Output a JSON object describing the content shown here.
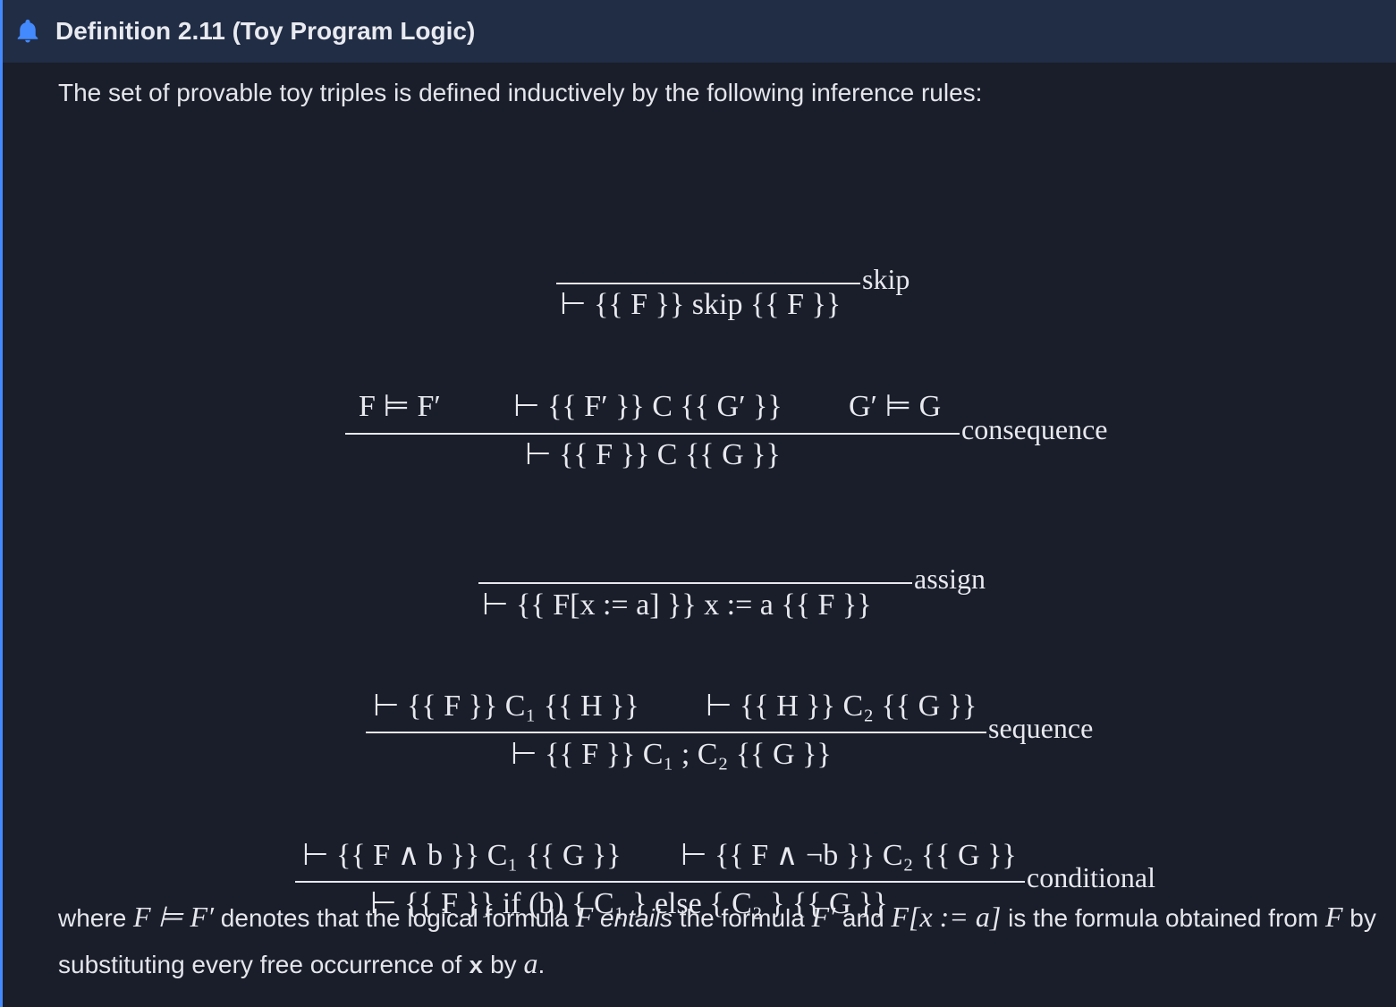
{
  "header": {
    "title": "Definition 2.11 (Toy Program Logic)",
    "icon": "bell-icon",
    "accent": "#448aff",
    "header_bg": "#212d45",
    "body_bg": "#1a1e2a"
  },
  "intro": "The set of provable toy triples is defined inductively by the following inference rules:",
  "rules": {
    "skip": {
      "name": "skip",
      "conclusion": "⊢ {{ F }} skip {{ F }}"
    },
    "consequence": {
      "name": "consequence",
      "premise_1": "F ⊨ F′",
      "premise_2": "⊢ {{ F′ }} C {{ G′ }}",
      "premise_3": "G′ ⊨ G",
      "conclusion": "⊢ {{ F }} C {{ G }}"
    },
    "assign": {
      "name": "assign",
      "conclusion": "⊢ {{ F[x := a] }} x := a {{ F }}"
    },
    "sequence": {
      "name": "sequence",
      "premise_1": "⊢ {{ F }} C₁ {{ H }}",
      "premise_2": "⊢ {{ H }} C₂ {{ G }}",
      "conclusion": "⊢ {{ F }} C₁ ; C₂ {{ G }}"
    },
    "conditional": {
      "name": "conditional",
      "premise_1": "⊢ {{ F ∧ b }} C₁ {{ G }}",
      "premise_2": "⊢ {{ F ∧ ¬b }} C₂ {{ G }}",
      "conclusion": "⊢ {{ F }} if (b) { C₁ } else { C₂ } {{ G }}"
    }
  },
  "footer": {
    "t1": "where ",
    "m1": "F ⊨ F′",
    "t2": " denotes that the logical formula ",
    "m2": "F",
    "t3": " ",
    "em": "entails",
    "t4": " the formula ",
    "m3": "F′",
    "t5": " and ",
    "m4": "F[x := a]",
    "t6": " is the formula obtained from ",
    "m5": "F",
    "t7": " by substituting every free occurrence of ",
    "m6": "x",
    "t8": " by ",
    "m7": "a",
    "t9": "."
  }
}
